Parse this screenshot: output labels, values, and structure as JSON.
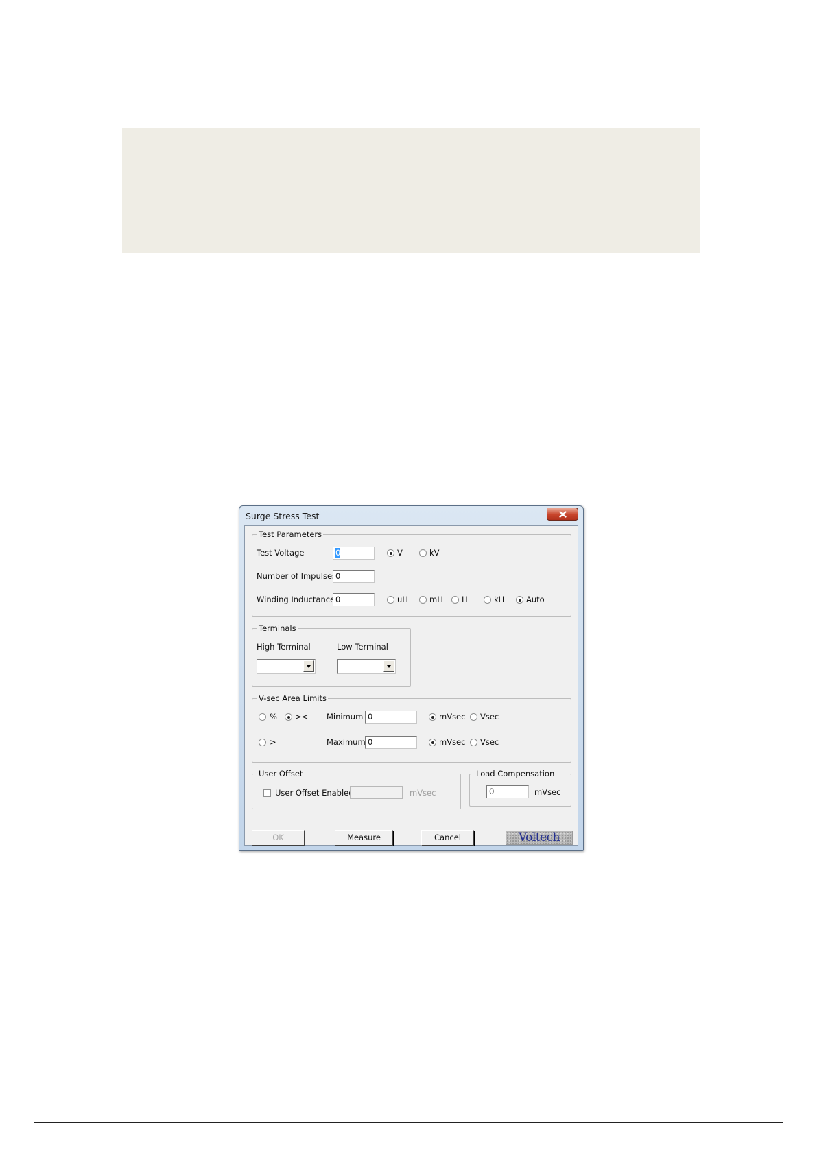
{
  "dialog": {
    "title": "Surge Stress Test",
    "test_parameters": {
      "legend": "Test Parameters",
      "test_voltage_label": "Test Voltage",
      "test_voltage_value": "0",
      "unit_v": "V",
      "unit_kv": "kV",
      "impulses_label": "Number of Impulses",
      "impulses_value": "0",
      "inductance_label": "Winding Inductance",
      "inductance_value": "0",
      "unit_uh": "uH",
      "unit_mh": "mH",
      "unit_h": "H",
      "unit_kh": "kH",
      "unit_auto": "Auto"
    },
    "terminals": {
      "legend": "Terminals",
      "high_label": "High Terminal",
      "high_value": "",
      "low_label": "Low Terminal",
      "low_value": ""
    },
    "vsec_limits": {
      "legend": "V-sec Area Limits",
      "mode_percent": "%",
      "mode_between": "><",
      "mode_greater": ">",
      "minimum_label": "Minimum",
      "minimum_value": "0",
      "maximum_label": "Maximum",
      "maximum_value": "0",
      "unit_mvsec": "mVsec",
      "unit_vsec": "Vsec"
    },
    "user_offset": {
      "legend": "User Offset",
      "enabled_label": "User Offset Enabled",
      "value": "",
      "unit": "mVsec"
    },
    "load_compensation": {
      "legend": "Load Compensation",
      "value": "0",
      "unit": "mVsec"
    },
    "buttons": {
      "ok": "OK",
      "measure": "Measure",
      "cancel": "Cancel"
    },
    "logo_text": "Voltech"
  }
}
